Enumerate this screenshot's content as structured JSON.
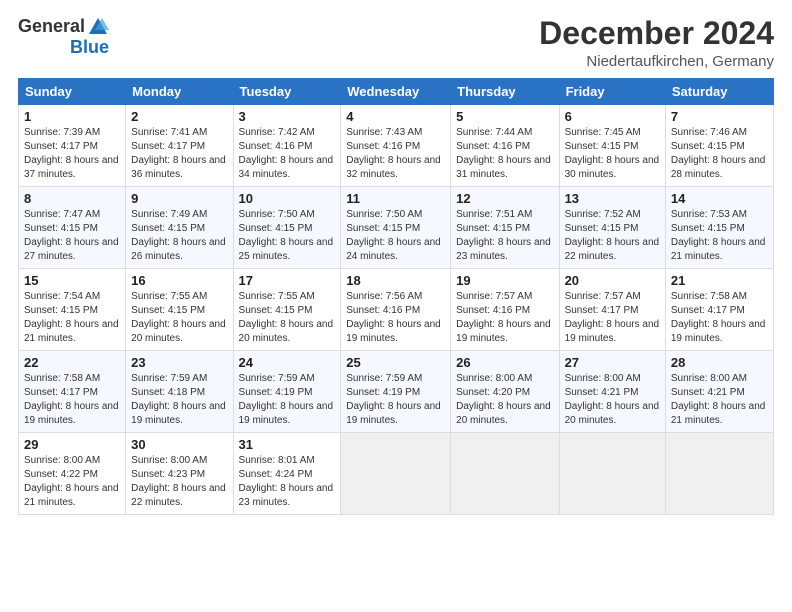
{
  "logo": {
    "general": "General",
    "blue": "Blue"
  },
  "header": {
    "month": "December 2024",
    "location": "Niedertaufkirchen, Germany"
  },
  "weekdays": [
    "Sunday",
    "Monday",
    "Tuesday",
    "Wednesday",
    "Thursday",
    "Friday",
    "Saturday"
  ],
  "weeks": [
    [
      {
        "day": "1",
        "sunrise": "Sunrise: 7:39 AM",
        "sunset": "Sunset: 4:17 PM",
        "daylight": "Daylight: 8 hours and 37 minutes."
      },
      {
        "day": "2",
        "sunrise": "Sunrise: 7:41 AM",
        "sunset": "Sunset: 4:17 PM",
        "daylight": "Daylight: 8 hours and 36 minutes."
      },
      {
        "day": "3",
        "sunrise": "Sunrise: 7:42 AM",
        "sunset": "Sunset: 4:16 PM",
        "daylight": "Daylight: 8 hours and 34 minutes."
      },
      {
        "day": "4",
        "sunrise": "Sunrise: 7:43 AM",
        "sunset": "Sunset: 4:16 PM",
        "daylight": "Daylight: 8 hours and 32 minutes."
      },
      {
        "day": "5",
        "sunrise": "Sunrise: 7:44 AM",
        "sunset": "Sunset: 4:16 PM",
        "daylight": "Daylight: 8 hours and 31 minutes."
      },
      {
        "day": "6",
        "sunrise": "Sunrise: 7:45 AM",
        "sunset": "Sunset: 4:15 PM",
        "daylight": "Daylight: 8 hours and 30 minutes."
      },
      {
        "day": "7",
        "sunrise": "Sunrise: 7:46 AM",
        "sunset": "Sunset: 4:15 PM",
        "daylight": "Daylight: 8 hours and 28 minutes."
      }
    ],
    [
      {
        "day": "8",
        "sunrise": "Sunrise: 7:47 AM",
        "sunset": "Sunset: 4:15 PM",
        "daylight": "Daylight: 8 hours and 27 minutes."
      },
      {
        "day": "9",
        "sunrise": "Sunrise: 7:49 AM",
        "sunset": "Sunset: 4:15 PM",
        "daylight": "Daylight: 8 hours and 26 minutes."
      },
      {
        "day": "10",
        "sunrise": "Sunrise: 7:50 AM",
        "sunset": "Sunset: 4:15 PM",
        "daylight": "Daylight: 8 hours and 25 minutes."
      },
      {
        "day": "11",
        "sunrise": "Sunrise: 7:50 AM",
        "sunset": "Sunset: 4:15 PM",
        "daylight": "Daylight: 8 hours and 24 minutes."
      },
      {
        "day": "12",
        "sunrise": "Sunrise: 7:51 AM",
        "sunset": "Sunset: 4:15 PM",
        "daylight": "Daylight: 8 hours and 23 minutes."
      },
      {
        "day": "13",
        "sunrise": "Sunrise: 7:52 AM",
        "sunset": "Sunset: 4:15 PM",
        "daylight": "Daylight: 8 hours and 22 minutes."
      },
      {
        "day": "14",
        "sunrise": "Sunrise: 7:53 AM",
        "sunset": "Sunset: 4:15 PM",
        "daylight": "Daylight: 8 hours and 21 minutes."
      }
    ],
    [
      {
        "day": "15",
        "sunrise": "Sunrise: 7:54 AM",
        "sunset": "Sunset: 4:15 PM",
        "daylight": "Daylight: 8 hours and 21 minutes."
      },
      {
        "day": "16",
        "sunrise": "Sunrise: 7:55 AM",
        "sunset": "Sunset: 4:15 PM",
        "daylight": "Daylight: 8 hours and 20 minutes."
      },
      {
        "day": "17",
        "sunrise": "Sunrise: 7:55 AM",
        "sunset": "Sunset: 4:15 PM",
        "daylight": "Daylight: 8 hours and 20 minutes."
      },
      {
        "day": "18",
        "sunrise": "Sunrise: 7:56 AM",
        "sunset": "Sunset: 4:16 PM",
        "daylight": "Daylight: 8 hours and 19 minutes."
      },
      {
        "day": "19",
        "sunrise": "Sunrise: 7:57 AM",
        "sunset": "Sunset: 4:16 PM",
        "daylight": "Daylight: 8 hours and 19 minutes."
      },
      {
        "day": "20",
        "sunrise": "Sunrise: 7:57 AM",
        "sunset": "Sunset: 4:17 PM",
        "daylight": "Daylight: 8 hours and 19 minutes."
      },
      {
        "day": "21",
        "sunrise": "Sunrise: 7:58 AM",
        "sunset": "Sunset: 4:17 PM",
        "daylight": "Daylight: 8 hours and 19 minutes."
      }
    ],
    [
      {
        "day": "22",
        "sunrise": "Sunrise: 7:58 AM",
        "sunset": "Sunset: 4:17 PM",
        "daylight": "Daylight: 8 hours and 19 minutes."
      },
      {
        "day": "23",
        "sunrise": "Sunrise: 7:59 AM",
        "sunset": "Sunset: 4:18 PM",
        "daylight": "Daylight: 8 hours and 19 minutes."
      },
      {
        "day": "24",
        "sunrise": "Sunrise: 7:59 AM",
        "sunset": "Sunset: 4:19 PM",
        "daylight": "Daylight: 8 hours and 19 minutes."
      },
      {
        "day": "25",
        "sunrise": "Sunrise: 7:59 AM",
        "sunset": "Sunset: 4:19 PM",
        "daylight": "Daylight: 8 hours and 19 minutes."
      },
      {
        "day": "26",
        "sunrise": "Sunrise: 8:00 AM",
        "sunset": "Sunset: 4:20 PM",
        "daylight": "Daylight: 8 hours and 20 minutes."
      },
      {
        "day": "27",
        "sunrise": "Sunrise: 8:00 AM",
        "sunset": "Sunset: 4:21 PM",
        "daylight": "Daylight: 8 hours and 20 minutes."
      },
      {
        "day": "28",
        "sunrise": "Sunrise: 8:00 AM",
        "sunset": "Sunset: 4:21 PM",
        "daylight": "Daylight: 8 hours and 21 minutes."
      }
    ],
    [
      {
        "day": "29",
        "sunrise": "Sunrise: 8:00 AM",
        "sunset": "Sunset: 4:22 PM",
        "daylight": "Daylight: 8 hours and 21 minutes."
      },
      {
        "day": "30",
        "sunrise": "Sunrise: 8:00 AM",
        "sunset": "Sunset: 4:23 PM",
        "daylight": "Daylight: 8 hours and 22 minutes."
      },
      {
        "day": "31",
        "sunrise": "Sunrise: 8:01 AM",
        "sunset": "Sunset: 4:24 PM",
        "daylight": "Daylight: 8 hours and 23 minutes."
      },
      null,
      null,
      null,
      null
    ]
  ]
}
